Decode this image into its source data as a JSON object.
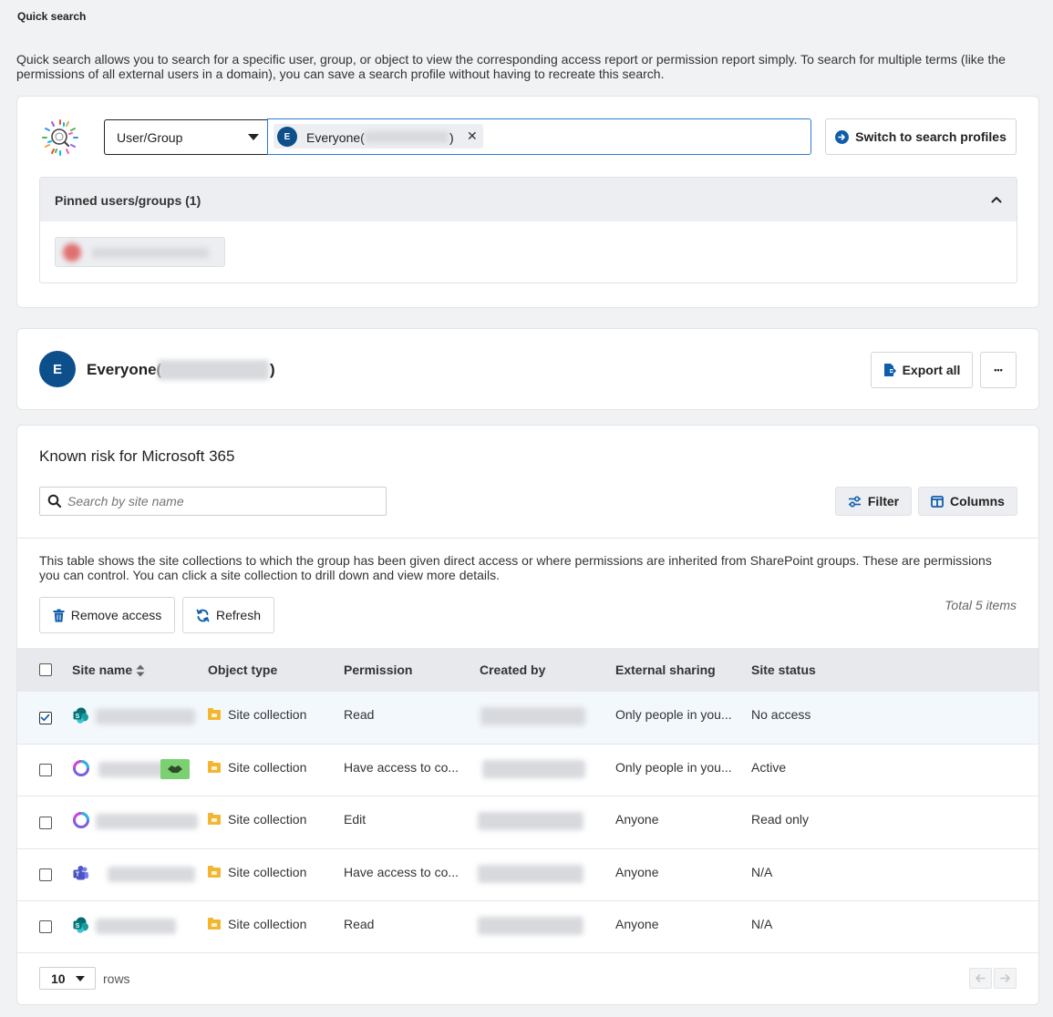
{
  "page": {
    "title": "Quick search",
    "intro": "Quick search allows you to search for a specific user, group, or object to view the corresponding access report or permission report simply. To search for multiple terms (like the permissions of all external users in a domain), you can save a search profile without having to recreate this search."
  },
  "search": {
    "type_value": "User/Group",
    "token_avatar": "E",
    "token_label_prefix": "Everyone(",
    "token_label_suffix": ")",
    "token_remove": "✕",
    "switch_label": "Switch to search profiles"
  },
  "pinned": {
    "header": "Pinned users/groups (1)"
  },
  "identity": {
    "avatar": "E",
    "name_prefix": "Everyone(",
    "name_suffix": ")",
    "export_label": "Export all",
    "more_label": "•••"
  },
  "risk": {
    "title": "Known risk for Microsoft 365",
    "search_placeholder": "Search by site name",
    "filter_label": "Filter",
    "columns_label": "Columns",
    "description": "This table shows the site collections to which the group has been given direct access or where permissions are inherited from SharePoint groups. These are permissions you can control. You can click a site collection to drill down and view more details.",
    "remove_label": "Remove access",
    "refresh_label": "Refresh",
    "total": "Total 5 items"
  },
  "table": {
    "headers": [
      "Site name",
      "Object type",
      "Permission",
      "Created by",
      "External sharing",
      "Site status"
    ],
    "rows": [
      {
        "checked": true,
        "icon": "sharepoint-icon",
        "object_type": "Site collection",
        "permission": "Read",
        "external": "Only people in you...",
        "status": "No access"
      },
      {
        "checked": false,
        "icon": "m365-group-icon",
        "object_type": "Site collection",
        "permission": "Have access to co...",
        "external": "Only people in you...",
        "status": "Active"
      },
      {
        "checked": false,
        "icon": "m365-group-icon",
        "object_type": "Site collection",
        "permission": "Edit",
        "external": "Anyone",
        "status": "Read only"
      },
      {
        "checked": false,
        "icon": "teams-icon",
        "object_type": "Site collection",
        "permission": "Have access to co...",
        "external": "Anyone",
        "status": "N/A"
      },
      {
        "checked": false,
        "icon": "sharepoint-icon",
        "object_type": "Site collection",
        "permission": "Read",
        "external": "Anyone",
        "status": "N/A"
      }
    ]
  },
  "pagination": {
    "rows_value": "10",
    "rows_label": "rows"
  },
  "colors": {
    "accent": "#0f5eab",
    "avatar": "#0c4f8a",
    "focus_border": "#2b7cd3",
    "folder": "#f3b632"
  }
}
